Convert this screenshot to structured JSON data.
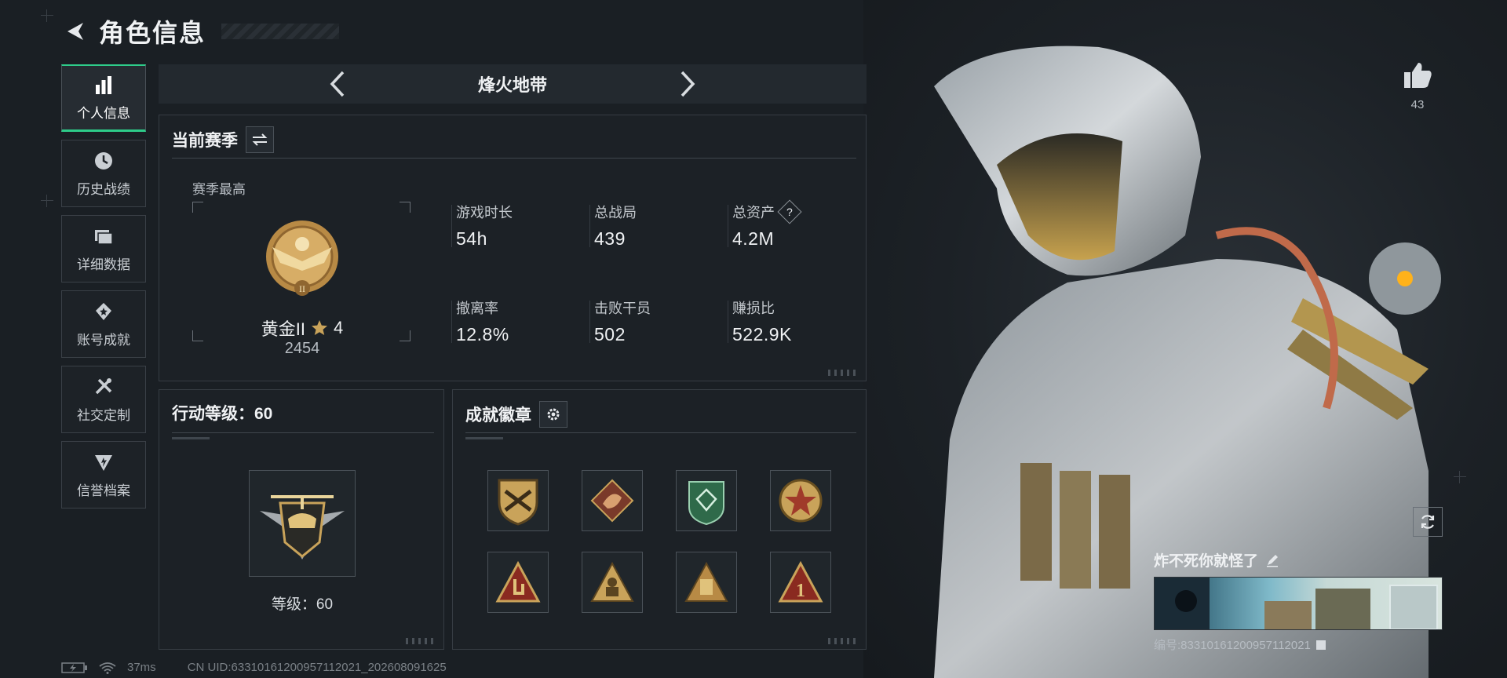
{
  "header": {
    "title": "角色信息"
  },
  "nav": {
    "items": [
      {
        "label": "个人信息",
        "icon": "bar-chart-icon",
        "active": true
      },
      {
        "label": "历史战绩",
        "icon": "history-icon",
        "active": false
      },
      {
        "label": "详细数据",
        "icon": "folder-icon",
        "active": false
      },
      {
        "label": "账号成就",
        "icon": "achievement-icon",
        "active": false
      },
      {
        "label": "社交定制",
        "icon": "tools-icon",
        "active": false
      },
      {
        "label": "信誉档案",
        "icon": "reputation-icon",
        "active": false
      }
    ]
  },
  "mode": {
    "title": "烽火地带"
  },
  "season": {
    "title": "当前赛季",
    "best_label": "赛季最高",
    "rank_name": "黄金II",
    "rank_stars": "4",
    "rank_score": "2454",
    "stats": [
      {
        "label": "游戏时长",
        "value": "54h"
      },
      {
        "label": "总战局",
        "value": "439"
      },
      {
        "label": "总资产",
        "value": "4.2M"
      },
      {
        "label": "撤离率",
        "value": "12.8%"
      },
      {
        "label": "击败干员",
        "value": "502"
      },
      {
        "label": "赚损比",
        "value": "522.9K"
      }
    ],
    "help_glyph": "?"
  },
  "level": {
    "title": "行动等级：60",
    "text": "等级：60"
  },
  "badges": {
    "title": "成就徽章"
  },
  "profile": {
    "likes": "43",
    "card_name": "炸不死你就怪了",
    "card_id": "编号:8331016120095711202​1"
  },
  "footer": {
    "ping": "37ms",
    "uid": "CN UID:6331016120095711202​1_202608091625"
  },
  "colors": {
    "accent": "#2ecc8a",
    "gold": "#c9a35a",
    "background": "#1a1f24"
  }
}
